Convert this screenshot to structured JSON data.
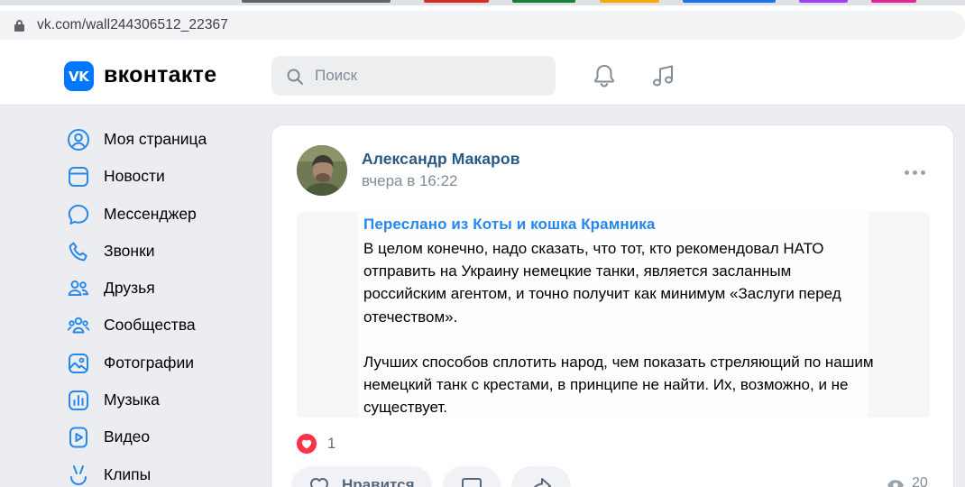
{
  "browser": {
    "url": "vk.com/wall244306512_22367",
    "tab_colors": [
      "#5f6368",
      "#d93025",
      "#188038",
      "#f9ab00",
      "#1a73e8",
      "#a142f4",
      "#e52592"
    ]
  },
  "header": {
    "brand": "вконтакте",
    "logo_text": "VK",
    "search_placeholder": "Поиск",
    "accent_color": "#0077ff"
  },
  "sidebar": {
    "items": [
      {
        "label": "Моя страница",
        "icon": "user-circle-icon"
      },
      {
        "label": "Новости",
        "icon": "newsfeed-icon"
      },
      {
        "label": "Мессенджер",
        "icon": "message-icon"
      },
      {
        "label": "Звонки",
        "icon": "phone-icon"
      },
      {
        "label": "Друзья",
        "icon": "friends-icon"
      },
      {
        "label": "Сообщества",
        "icon": "communities-icon"
      },
      {
        "label": "Фотографии",
        "icon": "photo-icon"
      },
      {
        "label": "Музыка",
        "icon": "music-icon"
      },
      {
        "label": "Видео",
        "icon": "video-icon"
      },
      {
        "label": "Клипы",
        "icon": "clips-icon"
      }
    ]
  },
  "post": {
    "author": "Александр Макаров",
    "time": "вчера в 16:22",
    "forwarded_from": "Переслано из Коты и кошка Крамника",
    "paragraphs": [
      "В целом конечно, надо сказать, что тот, кто рекомендовал НАТО отправить на Украину немецкие танки, является засланным российским агентом, и точно получит как минимум «Заслуги перед отечеством».",
      "Лучших способов сплотить народ, чем показать стреляющий по нашим немецкий танк с крестами, в принципе не найти. Их, возможно, и не существует."
    ],
    "likes": "1",
    "like_button": "Нравится",
    "views": "20"
  }
}
